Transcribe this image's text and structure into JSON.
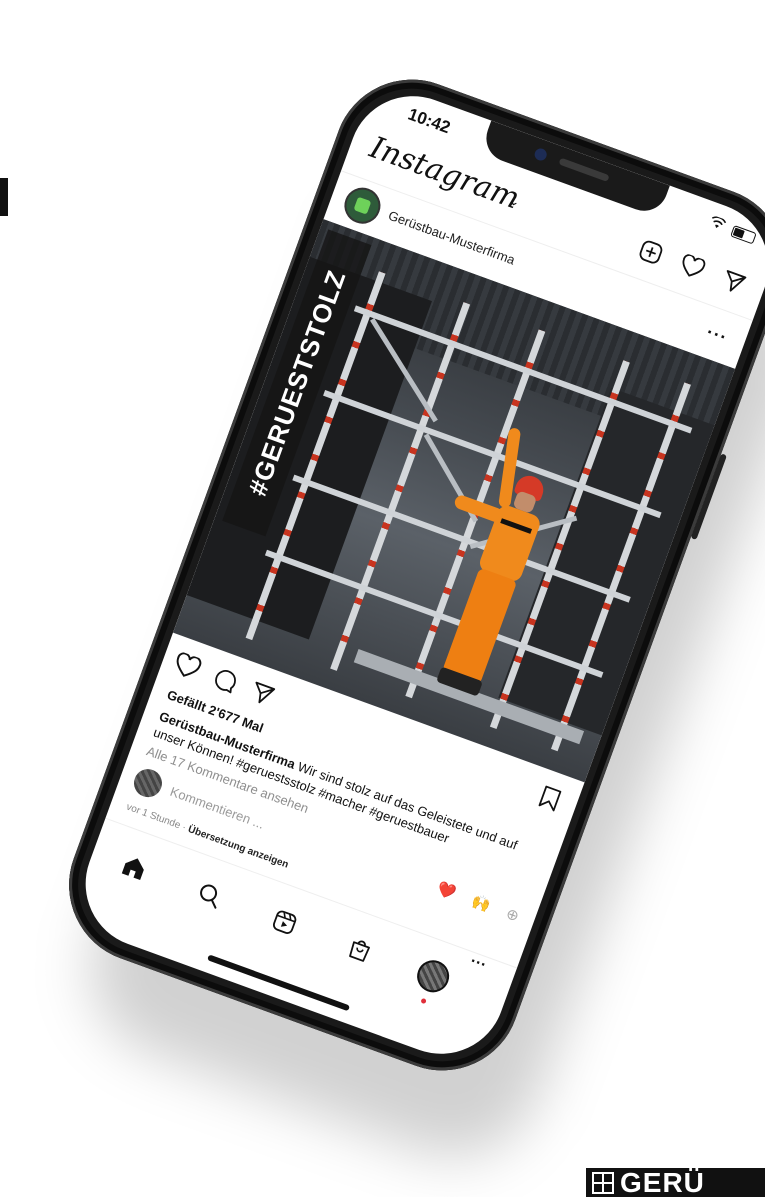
{
  "status": {
    "time": "10:42"
  },
  "app": {
    "logo": "Instagram"
  },
  "post": {
    "username": "Gerüstbau-Musterfirma",
    "hashtag_overlay": "#GERUESTSTOLZ",
    "likes": "Gefällt 2'677 Mal",
    "caption_user": "Gerüstbau-Musterfirma",
    "caption_text": "Wir sind stolz auf das Geleistete und auf unser Können! #geruestsstolz #macher #geruestbauer",
    "view_comments": "Alle 17 Kommentare ansehen",
    "comment_placeholder": "Kommentieren ...",
    "time_ago": "vor 1 Stunde",
    "translate": "Übersetzung anzeigen",
    "reactions": [
      "❤️",
      "🙌"
    ]
  },
  "brand": {
    "text": "GERÜ"
  },
  "icons": {
    "logo_chevron": "chevron-down-icon",
    "new_post": "plus-square-icon",
    "activity": "heart-icon",
    "direct": "paper-plane-icon",
    "more": "more-horizontal-icon",
    "like": "heart-icon",
    "comment": "comment-icon",
    "share": "paper-plane-icon",
    "save": "bookmark-icon",
    "home": "home-icon",
    "search": "search-icon",
    "reels": "reels-icon",
    "shop": "shopping-bag-icon"
  },
  "colors": {
    "notification_dot": "#e0303b",
    "reaction_heart": "#e0303b"
  }
}
